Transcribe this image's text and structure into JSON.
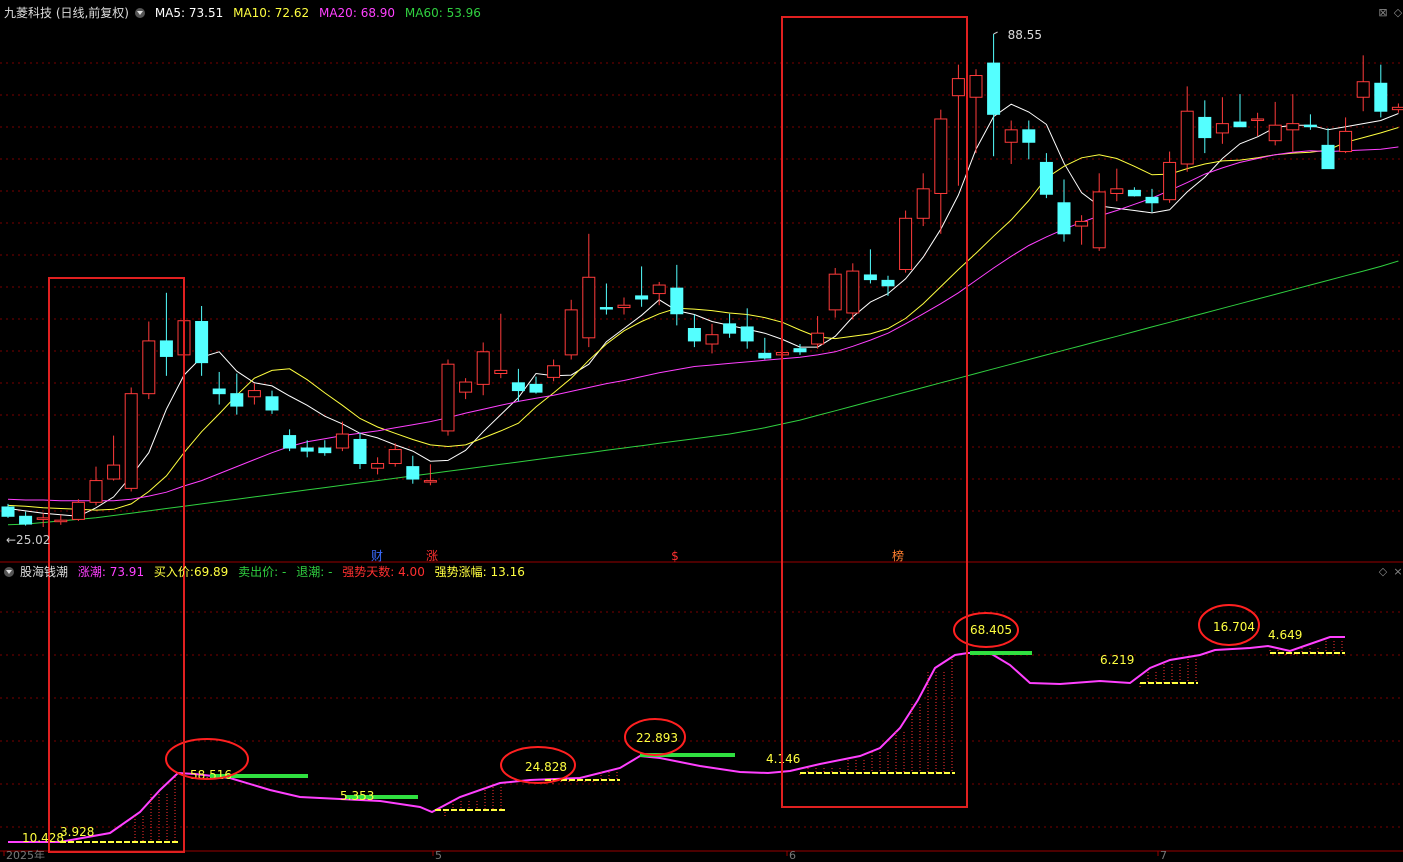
{
  "main_chart": {
    "title": "九菱科技 (日线,前复权)",
    "ma5": {
      "label": "MA5:",
      "value": "73.51",
      "color": "#ffffff"
    },
    "ma10": {
      "label": "MA10:",
      "value": "72.62",
      "color": "#ffff40"
    },
    "ma20": {
      "label": "MA20:",
      "value": "68.90",
      "color": "#ff40ff"
    },
    "ma60": {
      "label": "MA60:",
      "value": "53.96",
      "color": "#30d040"
    },
    "high_label": "88.55",
    "low_label": "←25.02",
    "event_markers": [
      "财",
      "涨",
      "$",
      "榜"
    ],
    "colors": {
      "up": "#ff3b3b",
      "down": "#54ffff",
      "grid": "#7a0000",
      "box": "#e02020"
    }
  },
  "sub_chart": {
    "title": "股海钱潮",
    "zhangchao": {
      "label": "涨潮:",
      "value": "73.91",
      "color": "#ff40ff"
    },
    "buy_price": {
      "label": "买入价:",
      "value": "69.89",
      "color": "#ffff40"
    },
    "sell_price": {
      "label": "卖出价:",
      "value": "-",
      "color": "#30d040"
    },
    "tuichao": {
      "label": "退潮:",
      "value": "-",
      "color": "#30d040"
    },
    "strong_days": {
      "label": "强势天数:",
      "value": "4.00",
      "color": "#ff3030"
    },
    "strong_gain": {
      "label": "强势涨幅:",
      "value": "13.16",
      "color": "#ffff40"
    },
    "value_labels": [
      "10.428",
      "3.928",
      "58.516",
      "5.353",
      "24.828",
      "22.893",
      "4.146",
      "68.405",
      "6.219",
      "16.704",
      "4.649"
    ],
    "circled_labels": [
      "58.516",
      "24.828",
      "22.893",
      "68.405",
      "16.704"
    ]
  },
  "time_axis": {
    "labels": [
      "2025年",
      "5",
      "6",
      "7"
    ]
  },
  "chart_data": {
    "type": "candlestick",
    "title": "九菱科技 (日线,前复权)",
    "series": [
      {
        "name": "price",
        "candles": [
          [
            27.6,
            28.0,
            26.2,
            26.4
          ],
          [
            26.4,
            27.0,
            25.2,
            25.4
          ],
          [
            26.0,
            26.8,
            25.02,
            26.2
          ],
          [
            25.8,
            26.6,
            25.3,
            25.9
          ],
          [
            26.0,
            28.6,
            25.8,
            28.2
          ],
          [
            28.2,
            32.8,
            27.8,
            31.0
          ],
          [
            31.2,
            36.8,
            31.0,
            33.0
          ],
          [
            30.0,
            43.0,
            29.6,
            42.2
          ],
          [
            42.2,
            51.5,
            41.5,
            49.0
          ],
          [
            49.0,
            55.2,
            44.5,
            47.0
          ],
          [
            47.2,
            53.0,
            45.0,
            51.6
          ],
          [
            51.5,
            53.5,
            44.5,
            46.2
          ],
          [
            42.8,
            45.0,
            40.8,
            42.2
          ],
          [
            42.2,
            44.8,
            39.5,
            40.6
          ],
          [
            41.8,
            43.5,
            40.8,
            42.6
          ],
          [
            41.8,
            42.6,
            39.6,
            40.1
          ],
          [
            36.8,
            37.6,
            34.8,
            35.2
          ],
          [
            35.2,
            36.2,
            34.0,
            34.8
          ],
          [
            35.2,
            36.2,
            34.2,
            34.6
          ],
          [
            35.2,
            38.6,
            34.8,
            37.0
          ],
          [
            36.3,
            37.2,
            32.5,
            33.2
          ],
          [
            32.6,
            34.0,
            31.8,
            33.2
          ],
          [
            33.2,
            35.8,
            32.8,
            35.0
          ],
          [
            32.8,
            34.2,
            30.6,
            31.2
          ],
          [
            30.9,
            33.1,
            30.4,
            31.0
          ],
          [
            37.4,
            46.6,
            36.8,
            46.0
          ],
          [
            42.4,
            44.2,
            41.5,
            43.7
          ],
          [
            43.4,
            48.8,
            42.0,
            47.6
          ],
          [
            44.8,
            52.5,
            44.2,
            45.2
          ],
          [
            43.6,
            45.4,
            41.2,
            42.6
          ],
          [
            43.4,
            44.4,
            42.2,
            42.4
          ],
          [
            44.3,
            46.6,
            43.8,
            45.8
          ],
          [
            47.2,
            54.3,
            46.6,
            53.0
          ],
          [
            49.4,
            62.8,
            48.2,
            57.2
          ],
          [
            53.3,
            56.4,
            52.4,
            53.2
          ],
          [
            53.3,
            54.6,
            52.4,
            53.6
          ],
          [
            54.8,
            58.6,
            53.4,
            54.4
          ],
          [
            55.1,
            56.6,
            53.6,
            56.2
          ],
          [
            55.8,
            58.8,
            51.0,
            52.5
          ],
          [
            50.6,
            52.4,
            48.2,
            49.0
          ],
          [
            48.6,
            51.2,
            47.4,
            49.8
          ],
          [
            51.2,
            52.5,
            49.4,
            50.0
          ],
          [
            50.8,
            53.2,
            48.0,
            49.0
          ],
          [
            47.4,
            49.4,
            46.6,
            46.8
          ],
          [
            47.2,
            48.1,
            46.6,
            47.5
          ],
          [
            48.0,
            48.6,
            47.2,
            47.6
          ],
          [
            48.6,
            52.2,
            48.0,
            50.0
          ],
          [
            53.0,
            58.4,
            52.0,
            57.6
          ],
          [
            52.6,
            59.0,
            51.8,
            58.0
          ],
          [
            57.5,
            60.8,
            56.4,
            56.9
          ],
          [
            56.8,
            57.4,
            54.8,
            56.1
          ],
          [
            58.2,
            65.8,
            57.8,
            64.8
          ],
          [
            64.8,
            70.6,
            63.8,
            68.6
          ],
          [
            68.0,
            78.8,
            62.8,
            77.6
          ],
          [
            80.6,
            84.6,
            69.0,
            82.8
          ],
          [
            80.4,
            84.0,
            73.2,
            83.2
          ],
          [
            84.8,
            88.55,
            72.8,
            78.2
          ],
          [
            74.6,
            77.4,
            71.8,
            76.2
          ],
          [
            76.2,
            77.4,
            72.4,
            74.6
          ],
          [
            72.0,
            73.2,
            67.4,
            67.9
          ],
          [
            66.8,
            69.8,
            61.8,
            62.8
          ],
          [
            63.8,
            65.2,
            61.4,
            64.4
          ],
          [
            61.0,
            70.6,
            60.6,
            68.2
          ],
          [
            68.0,
            71.2,
            67.0,
            68.6
          ],
          [
            68.4,
            68.8,
            67.6,
            67.7
          ],
          [
            67.5,
            68.6,
            65.6,
            66.8
          ],
          [
            67.2,
            73.4,
            66.8,
            72.0
          ],
          [
            71.8,
            81.8,
            70.8,
            78.6
          ],
          [
            77.8,
            80.0,
            73.2,
            75.2
          ],
          [
            75.8,
            80.4,
            74.4,
            77.0
          ],
          [
            77.2,
            80.8,
            76.6,
            76.6
          ],
          [
            77.6,
            78.4,
            75.4,
            77.6
          ],
          [
            74.8,
            79.8,
            74.2,
            76.8
          ],
          [
            76.2,
            80.8,
            73.4,
            77.0
          ],
          [
            76.8,
            78.2,
            76.2,
            76.6
          ],
          [
            74.2,
            76.4,
            71.2,
            71.2
          ],
          [
            73.4,
            77.8,
            73.2,
            76.0
          ],
          [
            80.4,
            85.8,
            78.6,
            82.4
          ],
          [
            82.2,
            84.6,
            77.8,
            78.6
          ],
          [
            78.8,
            79.6,
            78.4,
            79.1
          ]
        ]
      },
      {
        "name": "MA5",
        "values": [
          27.4,
          27.1,
          26.8,
          26.6,
          26.4,
          27.5,
          28.9,
          31.6,
          34.6,
          40.2,
          44.6,
          46.9,
          47.6,
          45.1,
          43.6,
          43.2,
          41.9,
          40.7,
          39.3,
          38.3,
          37.1,
          36.5,
          35.6,
          34.8,
          33.5,
          33.6,
          34.9,
          37.3,
          39.5,
          41.7,
          44.8,
          44.5,
          44.6,
          46.0,
          48.9,
          50.6,
          52.3,
          54.3,
          52.9,
          52.4,
          51.5,
          51.0,
          50.5,
          50.0,
          49.2,
          48.2,
          48.2,
          49.6,
          52.1,
          54.0,
          55.1,
          57.0,
          59.8,
          63.4,
          67.8,
          73.7,
          77.9,
          79.5,
          78.5,
          76.9,
          71.9,
          68.1,
          66.4,
          66.1,
          65.8,
          65.5,
          65.9,
          68.2,
          70.1,
          72.5,
          74.4,
          75.3,
          76.5,
          76.8,
          76.8,
          76.2,
          76.6,
          77.0,
          77.4,
          78.3
        ]
      },
      {
        "name": "MA10",
        "values": [
          27.8,
          27.7,
          27.5,
          27.4,
          27.3,
          27.2,
          27.3,
          28.0,
          29.6,
          31.6,
          34.6,
          37.3,
          39.6,
          42.0,
          44.2,
          45.2,
          45.4,
          44.0,
          42.3,
          40.7,
          39.0,
          37.9,
          37.1,
          36.3,
          35.6,
          35.4,
          35.6,
          36.5,
          37.4,
          38.4,
          40.5,
          42.3,
          44.2,
          46.5,
          48.6,
          50.3,
          51.5,
          52.5,
          53.2,
          53.1,
          52.9,
          52.6,
          52.4,
          52.0,
          51.4,
          50.4,
          49.5,
          49.3,
          49.6,
          49.9,
          50.6,
          51.9,
          53.8,
          56.0,
          58.2,
          60.3,
          62.5,
          64.6,
          67.1,
          70.0,
          71.5,
          72.6,
          73.0,
          72.5,
          71.5,
          70.4,
          70.5,
          71.2,
          71.8,
          72.2,
          72.3,
          72.6,
          73.0,
          73.2,
          73.3,
          73.6,
          74.6,
          75.2,
          75.8,
          76.5
        ]
      },
      {
        "name": "MA20",
        "values": [
          28.6,
          28.5,
          28.5,
          28.4,
          28.4,
          28.4,
          28.4,
          28.6,
          29.0,
          29.5,
          30.3,
          31.0,
          31.9,
          32.8,
          33.7,
          34.6,
          35.4,
          36.0,
          36.4,
          36.8,
          37.1,
          37.4,
          37.8,
          38.2,
          38.6,
          39.1,
          39.7,
          40.2,
          40.7,
          41.2,
          41.6,
          42.0,
          42.5,
          43.0,
          43.5,
          43.9,
          44.4,
          44.9,
          45.3,
          45.7,
          45.9,
          46.1,
          46.3,
          46.5,
          46.7,
          46.9,
          47.2,
          47.6,
          48.3,
          49.1,
          50.0,
          51.2,
          52.5,
          53.8,
          55.2,
          56.8,
          58.4,
          59.9,
          61.3,
          62.4,
          63.4,
          64.3,
          65.1,
          65.8,
          66.6,
          67.4,
          68.4,
          69.4,
          70.5,
          71.3,
          72.0,
          72.5,
          73.0,
          73.3,
          73.5,
          73.4,
          73.5,
          73.6,
          73.7,
          74.0
        ]
      },
      {
        "name": "MA60",
        "values": [
          25.3,
          25.4,
          25.6,
          25.8,
          26.0,
          26.2,
          26.5,
          26.8,
          27.1,
          27.4,
          27.7,
          28.0,
          28.3,
          28.6,
          28.9,
          29.2,
          29.5,
          29.8,
          30.1,
          30.4,
          30.7,
          31.0,
          31.3,
          31.6,
          31.9,
          32.2,
          32.5,
          32.8,
          33.1,
          33.4,
          33.7,
          34.0,
          34.3,
          34.6,
          34.9,
          35.2,
          35.5,
          35.8,
          36.1,
          36.4,
          36.7,
          37.0,
          37.4,
          37.8,
          38.3,
          38.8,
          39.4,
          40.0,
          40.6,
          41.2,
          41.8,
          42.4,
          43.0,
          43.6,
          44.2,
          44.8,
          45.4,
          46.0,
          46.6,
          47.2,
          47.8,
          48.4,
          49.0,
          49.6,
          50.2,
          50.8,
          51.4,
          52.0,
          52.6,
          53.2,
          53.8,
          54.4,
          55.0,
          55.6,
          56.2,
          56.8,
          57.4,
          58.0,
          58.6,
          59.3
        ]
      }
    ],
    "ylim": [
      25.02,
      88.55
    ]
  }
}
